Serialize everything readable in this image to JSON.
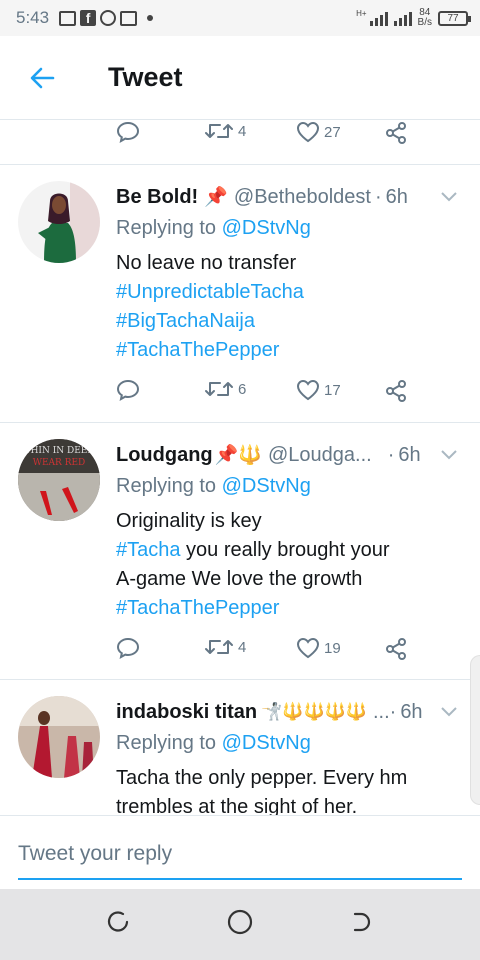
{
  "status_bar": {
    "time": "5:43",
    "net_type": "H+",
    "net_speed_value": "84",
    "net_speed_unit": "B/s",
    "battery": "77"
  },
  "header": {
    "title": "Tweet"
  },
  "colors": {
    "accent": "#1da1f2",
    "secondary": "#657786",
    "text": "#14171a",
    "divider": "#e1e8ed"
  },
  "top_actions": {
    "reply_count": "",
    "retweet_count": "4",
    "like_count": "27"
  },
  "tweets": [
    {
      "name": "Be Bold!",
      "emoji": "📌",
      "handle": "@Betheboldest",
      "sep": "·",
      "time": "6h",
      "reply_prefix": "Replying to",
      "reply_to": "@DStvNg",
      "text_line": "No leave no transfer",
      "hashtags": [
        "#UnpredictableTacha",
        "#BigTachaNaija",
        "#TachaThePepper"
      ],
      "retweet_count": "6",
      "like_count": "17"
    },
    {
      "name": "Loudgang",
      "emoji": "📌🔱",
      "handle": "@Loudga...",
      "sep": "·",
      "time": "6h",
      "reply_prefix": "Replying to",
      "reply_to": "@DStvNg",
      "text_line": "Originality is key",
      "hashtag_inline": "#Tacha",
      "text_after_inline": " you really brought your",
      "text_line3": "A-game We love the growth",
      "hashtag_last": "#TachaThePepper",
      "retweet_count": "4",
      "like_count": "19"
    },
    {
      "name": "indaboski titan",
      "emoji": "🤺🔱🔱🔱🔱",
      "handle": "...",
      "sep": "·",
      "time": "6h",
      "reply_prefix": "Replying to",
      "reply_to": "@DStvNg",
      "text_line": "Tacha the only pepper. Every hm",
      "text_line2": "trembles at the sight of her."
    }
  ],
  "reply_bar": {
    "placeholder": "Tweet your reply"
  },
  "icons": [
    "back-arrow-icon",
    "reply-icon",
    "retweet-icon",
    "like-icon",
    "share-icon",
    "chevron-down-icon",
    "recent-apps-icon",
    "home-icon",
    "back-nav-icon"
  ]
}
